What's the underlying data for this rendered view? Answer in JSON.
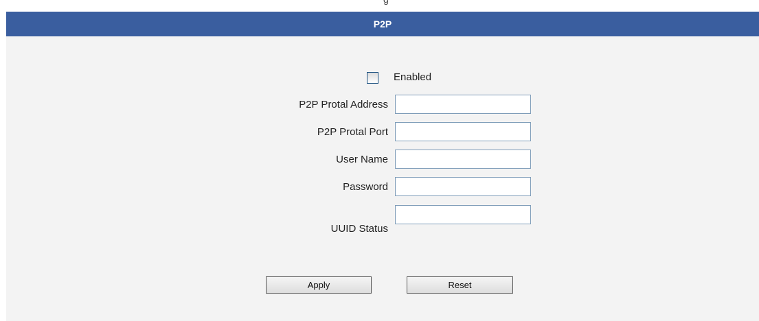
{
  "header": {
    "title": "P2P"
  },
  "top_strip": {
    "cut_text": "g"
  },
  "enabled": {
    "label": "Enabled",
    "checked": false
  },
  "fields": [
    {
      "label": "P2P Protal Address",
      "value": ""
    },
    {
      "label": "P2P Protal Port",
      "value": ""
    },
    {
      "label": "User Name",
      "value": ""
    },
    {
      "label": "Password",
      "value": ""
    },
    {
      "label": "UUID Status",
      "value": ""
    }
  ],
  "buttons": {
    "apply_label": "Apply",
    "reset_label": "Reset"
  },
  "colors": {
    "header_bg": "#3a5e9f",
    "panel_bg": "#f3f3f3",
    "field_border": "#7f9db9"
  }
}
